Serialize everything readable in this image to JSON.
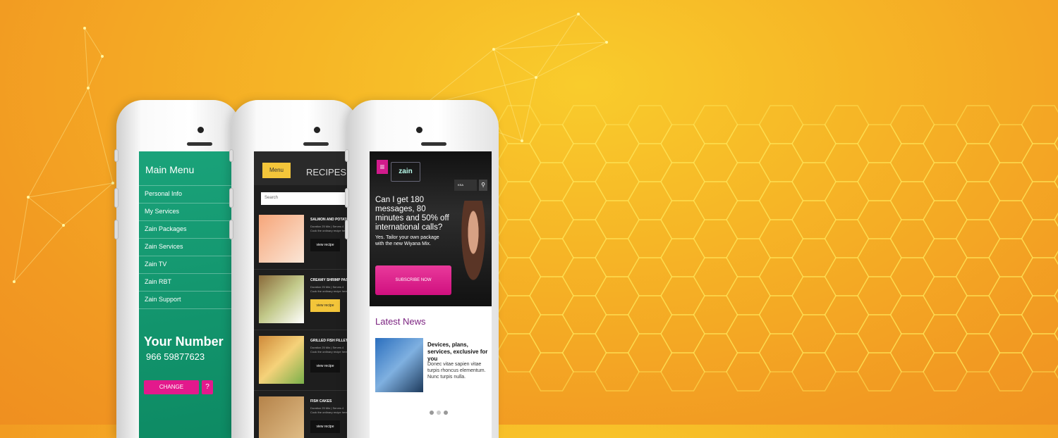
{
  "background": {
    "colors": {
      "center": "#f9cc2c",
      "edge": "#ef8f20"
    },
    "pattern": "hexagon-grid-and-network-lines"
  },
  "phone_menu": {
    "title": "Main Menu",
    "items": [
      {
        "label": "Personal Info"
      },
      {
        "label": "My Services"
      },
      {
        "label": "Zain Packages"
      },
      {
        "label": "Zain Services"
      },
      {
        "label": "Zain TV"
      },
      {
        "label": "Zain RBT"
      },
      {
        "label": "Zain Support"
      }
    ],
    "your_number_label": "Your Number",
    "number": "966 59877623",
    "change_label": "CHANGE",
    "help_label": "?",
    "colors": {
      "bg": "#129a70",
      "accent": "#e3198c"
    }
  },
  "phone_recipes": {
    "menu_label": "Menu",
    "title": "RECIPES",
    "search_placeholder": "Search",
    "recipes": [
      {
        "name": "SALMON AND POTATO B...",
        "meta": "Duration 25 Min | Serves 4",
        "meta2": "Cook the ordinary recipe here and",
        "view": "view recipe"
      },
      {
        "name": "CREAMY SHRIMP PASTA",
        "meta": "Duration 25 Min | Serves 4",
        "meta2": "Cook the ordinary recipe here and",
        "view": "view recipe"
      },
      {
        "name": "GRILLED FISH FILLET",
        "meta": "Duration 25 Min | Serves 4",
        "meta2": "Cook the ordinary recipe here and",
        "view": "view recipe"
      },
      {
        "name": "FISH CAKES",
        "meta": "Duration 25 Min | Serves 4",
        "meta2": "Cook the ordinary recipe here and",
        "view": "view recipe"
      }
    ],
    "colors": {
      "accent": "#f3c53a"
    }
  },
  "phone_zain": {
    "logo": "zain",
    "lang_select": "KSA",
    "headline": "Can I get 180 messages, 80 minutes and 50% off international calls?",
    "subline": "Yes. Tailor your own package with the new Wiyana Mix.",
    "cta": "SUBSCRIBE NOW",
    "news_title": "Latest News",
    "news_item_title": "Devices, plans, services, exclusive for you",
    "news_item_text": "Donec vitae sapien vitae turpis rhoncus elementum. Nunc turpis nulla.",
    "colors": {
      "accent": "#d21b8c",
      "news": "#7b2380"
    }
  }
}
